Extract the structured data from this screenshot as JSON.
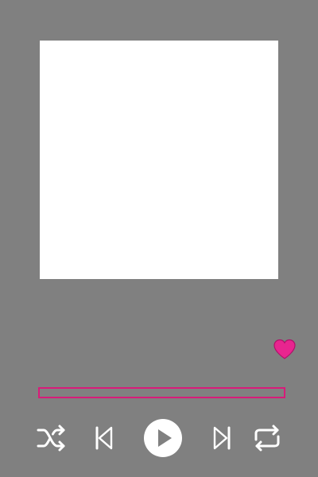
{
  "player": {
    "accent_color": "#d81b7a",
    "background_color": "#808080",
    "album_art_color": "#ffffff",
    "icon_color": "#ffffff",
    "liked": true,
    "progress": 0
  },
  "controls": {
    "shuffle_icon": "shuffle-icon",
    "previous_icon": "skip-previous-icon",
    "play_icon": "play-icon",
    "next_icon": "skip-next-icon",
    "repeat_icon": "repeat-icon",
    "like_icon": "heart-icon"
  }
}
